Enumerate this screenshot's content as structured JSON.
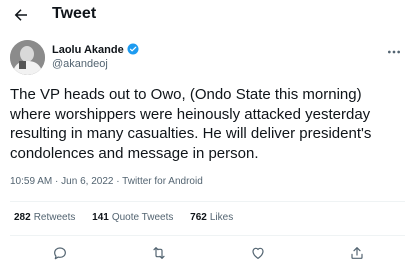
{
  "header": {
    "title": "Tweet",
    "back_icon": "arrow-left-icon"
  },
  "author": {
    "name": "Laolu Akande",
    "handle": "@akandeoj",
    "verified": true,
    "verified_color": "#1d9bf0"
  },
  "tweet": {
    "text": "The VP heads out to Owo, (Ondo State this morning)\nwhere worshippers were heinously attacked yesterday\nresulting in many casualties. He will deliver president's\ncondolences and message in person.",
    "time": "10:59 AM",
    "date": "Jun 6, 2022",
    "source": "Twitter for Android",
    "separator": "·"
  },
  "stats": {
    "retweets": {
      "count": "282",
      "label": "Retweets"
    },
    "quote_tweets": {
      "count": "141",
      "label": "Quote Tweets"
    },
    "likes": {
      "count": "762",
      "label": "Likes"
    }
  },
  "actions": [
    "reply-icon",
    "retweet-icon",
    "like-icon",
    "share-icon"
  ],
  "colors": {
    "text": "#0f1419",
    "secondary": "#536471",
    "divider": "#eff3f4"
  }
}
